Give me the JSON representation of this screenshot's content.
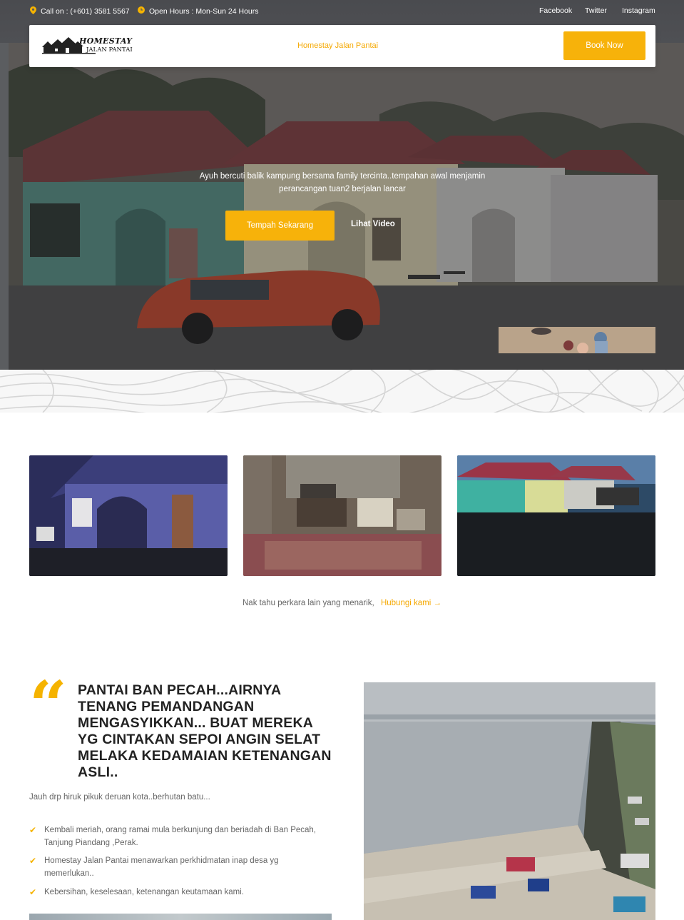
{
  "topbar": {
    "call": "Call on : (+601) 3581 5567",
    "hours": "Open Hours : Mon-Sun 24 Hours",
    "social": [
      "Facebook",
      "Twitter",
      "Instagram"
    ]
  },
  "nav": {
    "logo_line1": "HOMESTAY",
    "logo_line2": "JALAN PANTAI",
    "link": "Homestay Jalan Pantai",
    "book_button": "Book Now"
  },
  "hero": {
    "text": "Ayuh bercuti balik kampung bersama family tercinta..tempahan awal menjamin perancangan tuan2 berjalan lancar",
    "primary_button": "Tempah Sekarang",
    "video_button": "Lihat Video"
  },
  "gallery": {
    "more_text": "Nak tahu perkara lain yang menarik,",
    "more_link": "Hubungi kami",
    "arrow_icon": "arrow-right-icon"
  },
  "feature": {
    "quote_icon": "quote-icon",
    "headline": "PANTAI BAN PECAH...AIRNYA TENANG PEMANDANGAN MENGASYIKKAN... BUAT MEREKA YG CINTAKAN SEPOI ANGIN SELAT MELAKA KEDAMAIAN KETENANGAN ASLI..",
    "subtext": "Jauh drp hiruk pikuk deruan kota..berhutan batu...",
    "items": [
      "Kembali meriah, orang ramai mula berkunjung dan beriadah di Ban Pecah, Tanjung Piandang ,Perak.",
      "Homestay Jalan Pantai menawarkan perkhidmatan inap desa yg memerlukan..",
      "Kebersihan, keselesaan, ketenangan keutamaan kami."
    ]
  },
  "colors": {
    "accent": "#f7b20a",
    "text_muted": "#666666",
    "heading": "#222222"
  }
}
